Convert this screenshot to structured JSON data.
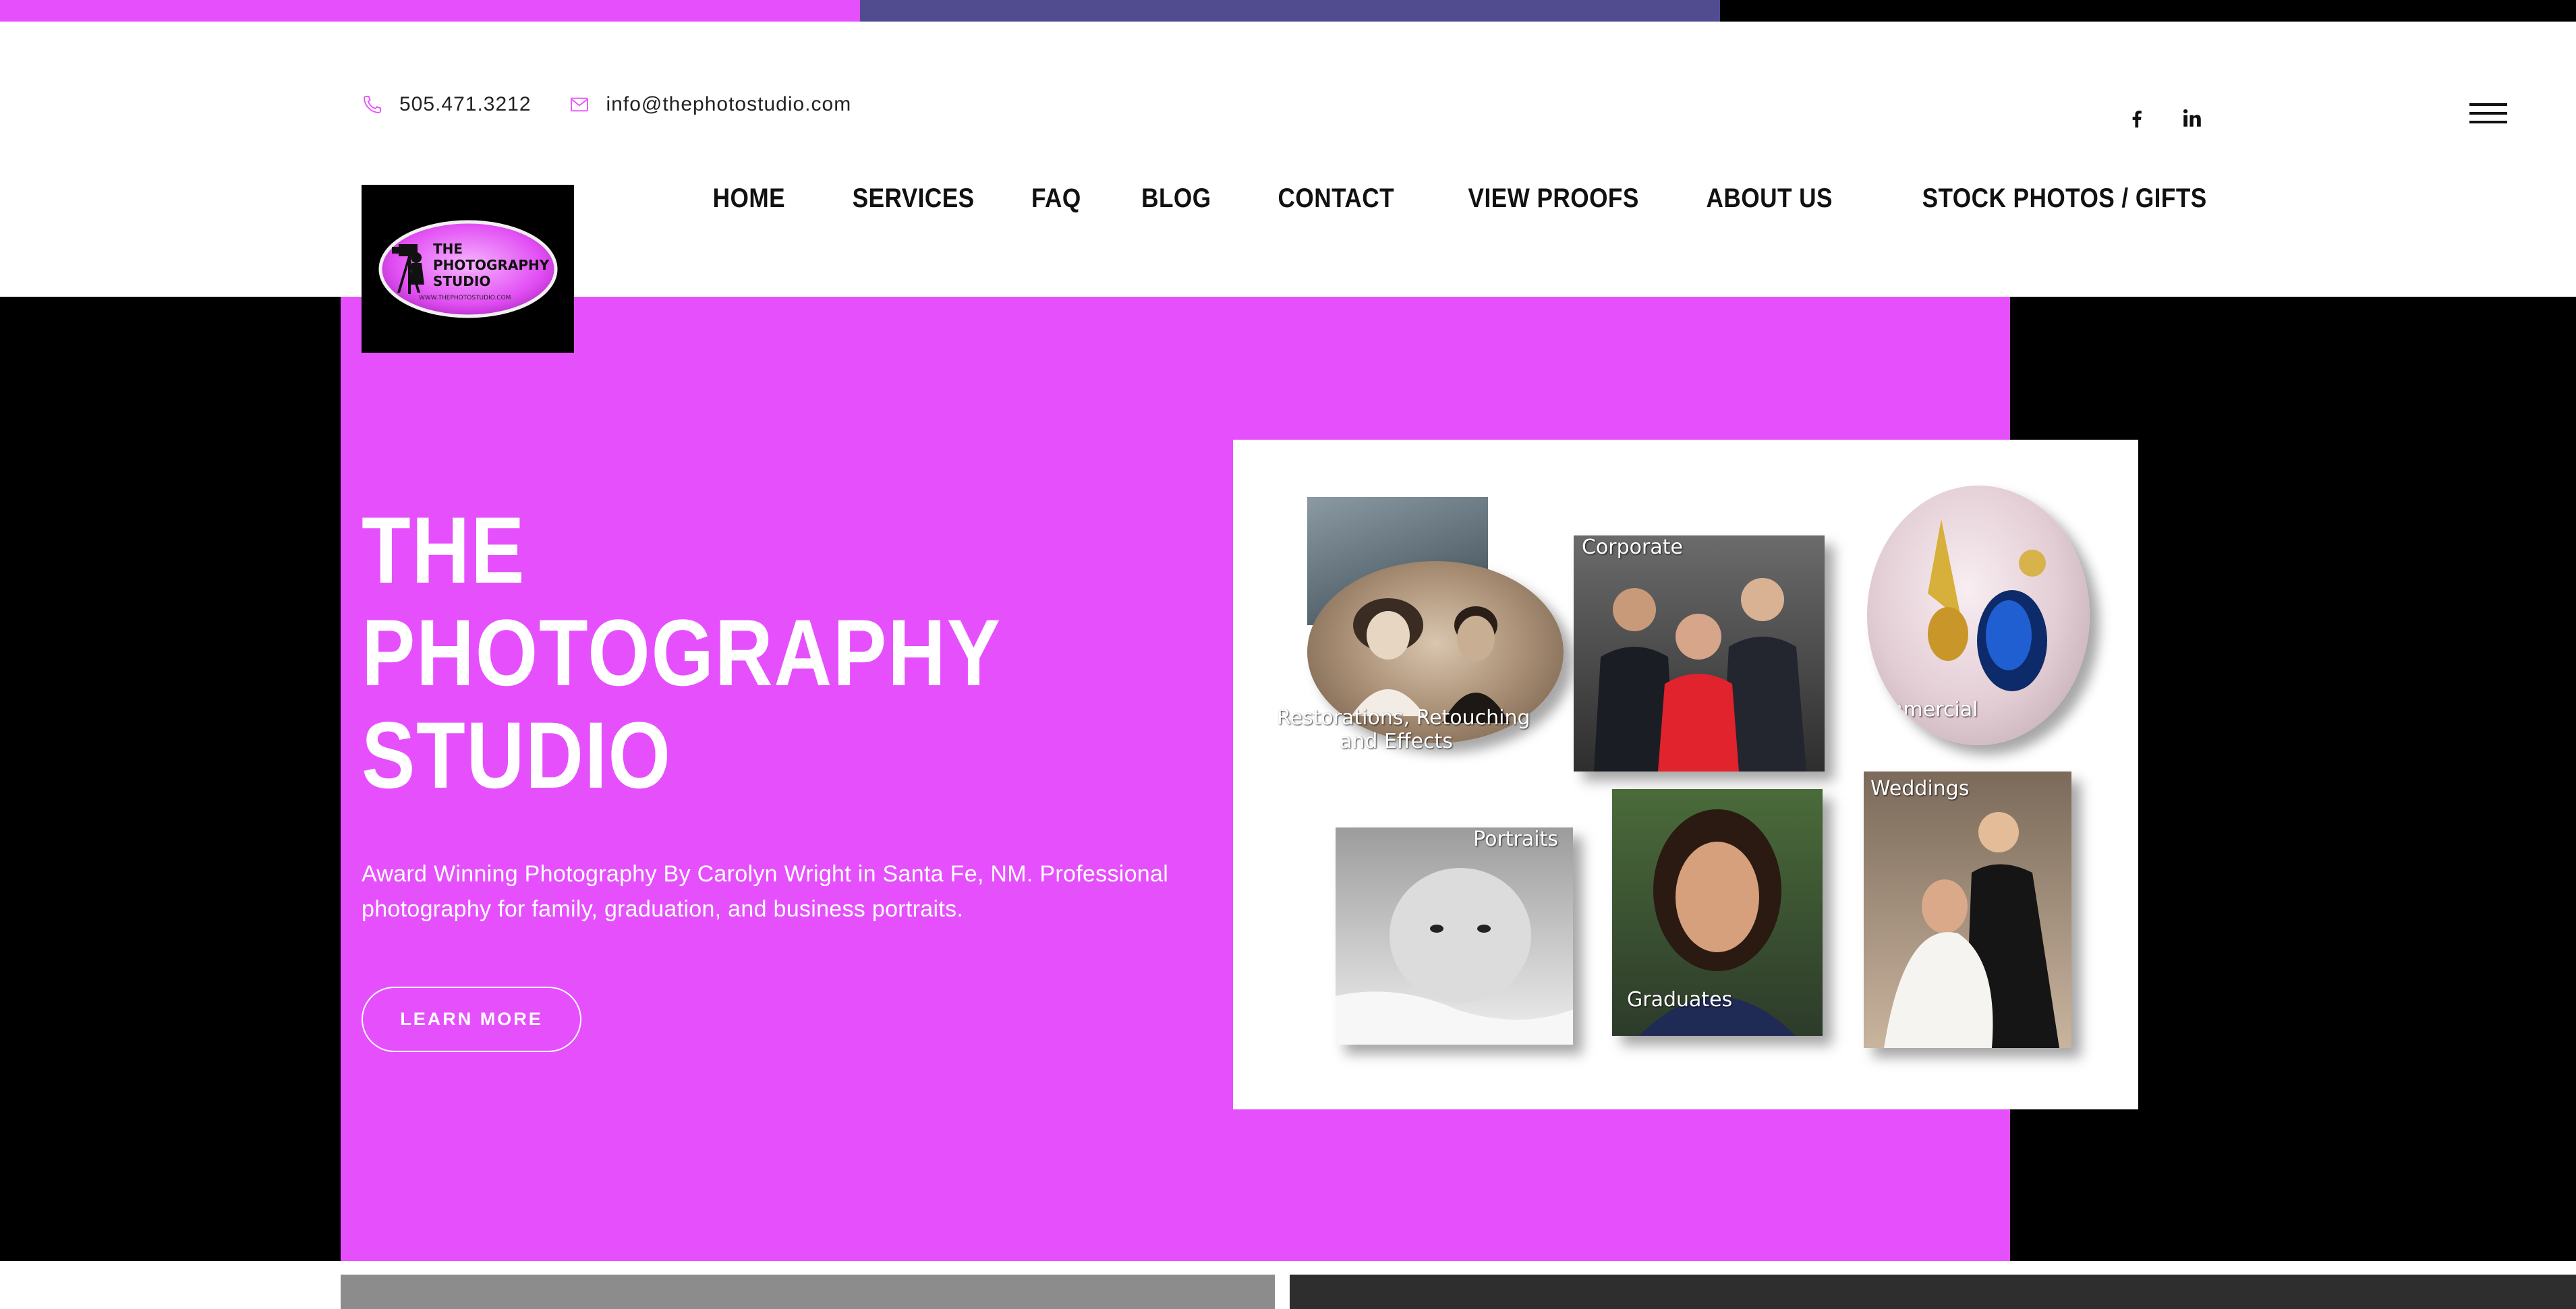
{
  "header": {
    "phone": "505.471.3212",
    "email": "info@thephotostudio.com",
    "social": [
      "facebook-icon",
      "linkedin-icon"
    ]
  },
  "logo": {
    "line1": "THE",
    "line2": "PHOTOGRAPHY",
    "line3": "STUDIO",
    "url": "WWW.THEPHOTOSTUDIO.COM"
  },
  "nav": {
    "items": [
      "HOME",
      "SERVICES",
      "FAQ",
      "BLOG",
      "CONTACT",
      "VIEW PROOFS",
      "ABOUT US",
      "STOCK PHOTOS / GIFTS"
    ]
  },
  "hero": {
    "title_lines": [
      "THE",
      "PHOTOGRAPHY",
      "STUDIO"
    ],
    "description": "Award Winning Photography By Carolyn Wright in Santa Fe, NM. Professional photography for family, graduation, and business portraits.",
    "button": "LEARN MORE"
  },
  "collage": {
    "restorations": "Restorations, Retouching",
    "restorations2": "and Effects",
    "corporate": "Corporate",
    "commercial": "Commercial",
    "portraits": "Portraits",
    "graduates": "Graduates",
    "weddings": "Weddings"
  },
  "colors": {
    "accent": "#e650fc",
    "purple": "#514c8f",
    "black": "#000000"
  }
}
